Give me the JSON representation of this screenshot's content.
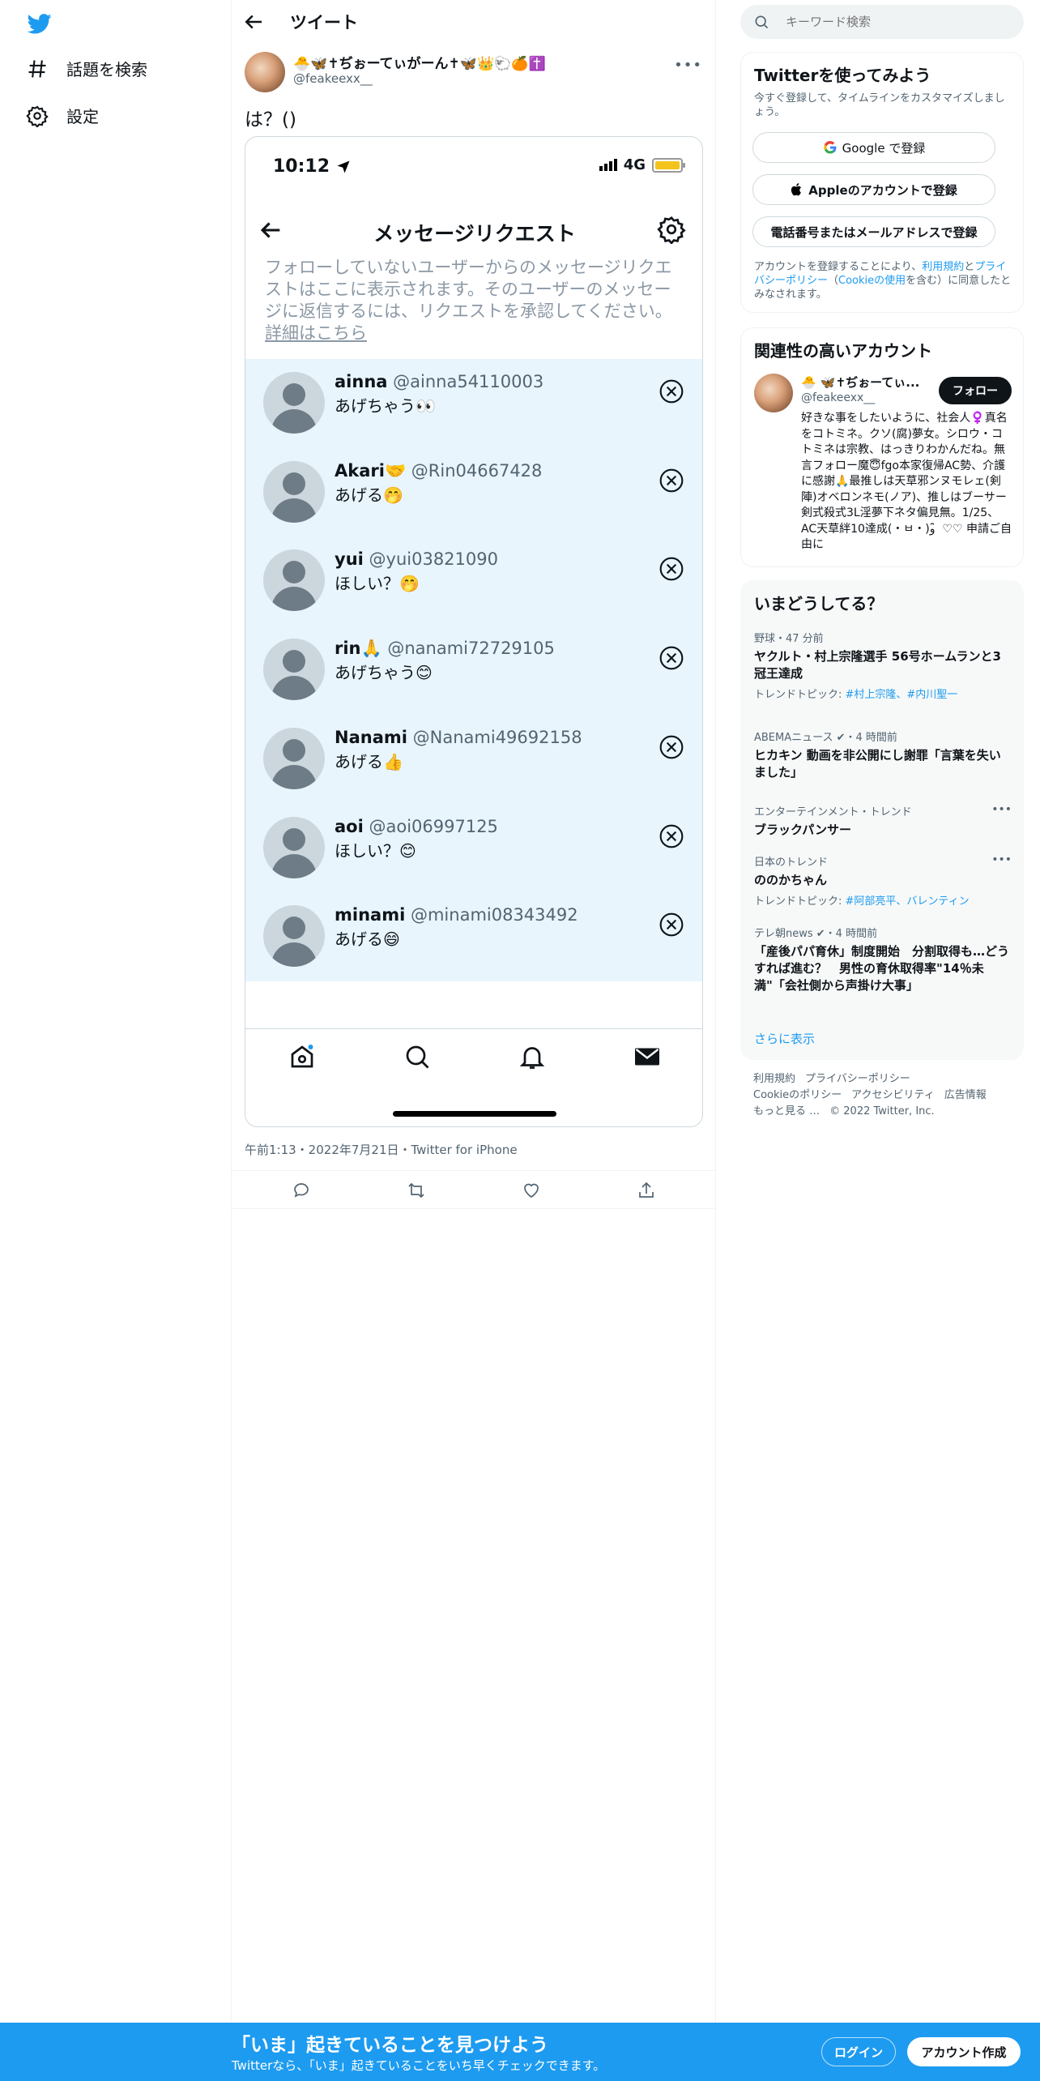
{
  "nav": {
    "explore_label": "話題を検索",
    "settings_label": "設定"
  },
  "header": {
    "title": "ツイート"
  },
  "tweet": {
    "author_name": "🐣🦋✝ぢぉーてぃがーん✝🦋👑🐑🍊✝️",
    "author_handle": "@feakeexx__",
    "text": "は？()",
    "meta": "午前1:13・2022年7月21日・Twitter for iPhone"
  },
  "screenshot": {
    "time": "10:12",
    "network": "4G",
    "title": "メッセージリクエスト",
    "description": "フォローしていないユーザーからのメッセージリクエストはここに表示されます。そのユーザーのメッセージに返信するには、リクエストを承認してください。",
    "learn_more": "詳細はこちら",
    "requests": [
      {
        "name": "ainna",
        "handle": "@ainna54110003",
        "message": "あげちゃう👀"
      },
      {
        "name": "Akari🤝",
        "handle": "@Rin04667428",
        "message": "あげる🤭"
      },
      {
        "name": "yui",
        "handle": "@yui03821090",
        "message": "ほしい？🤭"
      },
      {
        "name": "rin🙏",
        "handle": "@nanami72729105",
        "message": "あげちゃう😊"
      },
      {
        "name": "Nanami",
        "handle": "@Nanami49692158",
        "message": "あげる👍"
      },
      {
        "name": "aoi",
        "handle": "@aoi06997125",
        "message": "ほしい？😊"
      },
      {
        "name": "minami",
        "handle": "@minami08343492",
        "message": "あげる😄"
      }
    ]
  },
  "search": {
    "placeholder": "キーワード検索"
  },
  "signup_card": {
    "title": "Twitterを使ってみよう",
    "subtitle": "今すぐ登録して、タイムラインをカスタマイズしましょう。",
    "google_label": "Google で登録",
    "apple_label": "Appleのアカウントで登録",
    "phone_label": "電話番号またはメールアドレスで登録",
    "terms_prefix": "アカウントを登録することにより、",
    "terms_link": "利用規約",
    "terms_and": "と",
    "privacy_link": "プライバシーポリシー",
    "cookie_open": "（",
    "cookie_link": "Cookieの使用",
    "cookie_suffix": "を含む）に同意したとみなされます。"
  },
  "related": {
    "title": "関連性の高いアカウント",
    "name": "🐣 🦋✝ぢぉーてぃ...",
    "handle": "@feakeexx__",
    "follow_label": "フォロー",
    "bio": "好きな事をしたいように、社会人♀️真名をコトミネ。クソ(腐)夢女。シロウ・コトミネは宗教、はっきりわかんだね。無言フォロー魔😇fgo本家復帰AC勢、介護に感謝🙏最推しは天草邪ンヌモレェ(剣陣)オベロンネモ(ノア)、推しはブーサー剣式殺式3L淫夢下ネタ偏見無。1/25、AC天草絆10達成(・ㅂ・)ﻭ ̑̑ ♡♡ 申請ご自由に"
  },
  "trends": {
    "title": "いまどうしてる？",
    "items": [
      {
        "meta": "野球・47 分前",
        "title": "ヤクルト・村上宗隆選手 56号ホームランと3冠王達成",
        "sub_prefix": "トレンドトピック: ",
        "sub_links": "#村上宗隆、#内川聖一"
      },
      {
        "meta": "ABEMAニュース ✔・4 時間前",
        "title": "ヒカキン 動画を非公開にし謝罪「言葉を失いました」"
      },
      {
        "meta": "エンターテインメント・トレンド",
        "title": "ブラックパンサー"
      },
      {
        "meta": "日本のトレンド",
        "title": "ののかちゃん",
        "sub_prefix": "トレンドトピック: ",
        "sub_links": "#阿部亮平、バレンティン"
      },
      {
        "meta": "テレ朝news ✔・4 時間前",
        "title": "「産後パパ育休」制度開始　分割取得も…どうすれば進む？　男性の育休取得率\"14％未満\"「会社側から声掛け大事」"
      }
    ],
    "show_more": "さらに表示"
  },
  "footer": {
    "links": [
      "利用規約",
      "プライバシーポリシー",
      "Cookieのポリシー",
      "アクセシビリティ",
      "広告情報",
      "もっと見る …"
    ],
    "copyright": "© 2022 Twitter, Inc."
  },
  "bottom_bar": {
    "title": "「いま」起きていることを見つけよう",
    "subtitle": "Twitterなら、「いま」起きていることをいち早くチェックできます。",
    "login_label": "ログイン",
    "signup_label": "アカウント作成"
  },
  "colors": {
    "accent": "#1d9bf0",
    "request_bg": "#e8f5fd",
    "battery": "#f3c41b"
  }
}
